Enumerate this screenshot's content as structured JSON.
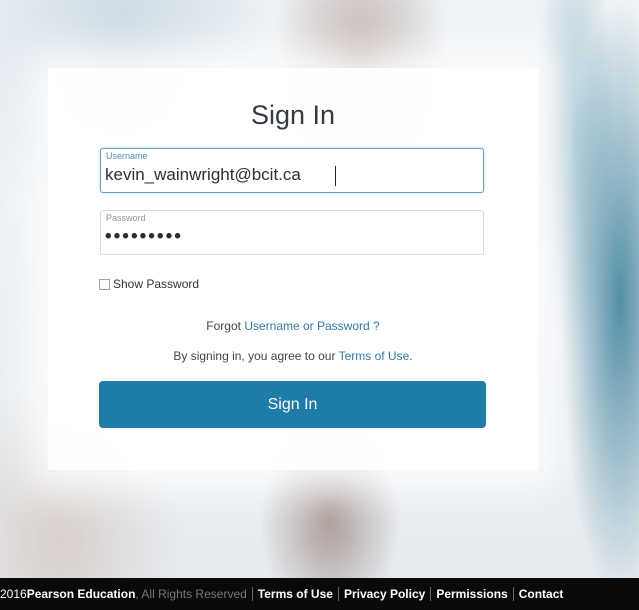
{
  "signin": {
    "title": "Sign In",
    "username": {
      "label": "Username",
      "value": "kevin_wainwright@bcit.ca"
    },
    "password": {
      "label": "Password",
      "masked_value": "•••••••••"
    },
    "show_password_label": "Show Password",
    "forgot": {
      "prefix": "Forgot ",
      "link": "Username or Password ?"
    },
    "agree": {
      "prefix": "By signing in, you agree to our ",
      "link": "Terms of Use",
      "suffix": "."
    },
    "button_label": "Sign In"
  },
  "footer": {
    "copyright_prefix": "2016 ",
    "company": "Pearson Education",
    "rights": ", All Rights Reserved",
    "links": [
      "Terms of Use",
      "Privacy Policy",
      "Permissions",
      "Contact"
    ]
  },
  "colors": {
    "accent": "#1f7ba7",
    "link": "#2f7bb0",
    "footer_bg": "#0a0a0a"
  }
}
